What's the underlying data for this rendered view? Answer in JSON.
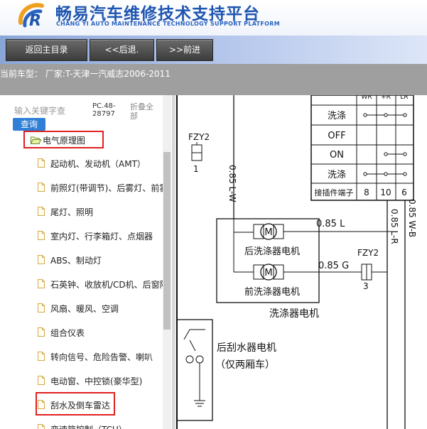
{
  "header": {
    "title_cn": "畅易汽车维修技术支持平台",
    "title_en": "CHANG YI AUTO MAINTENANCE TECHNOLOGY SUPPORT PLATFORM"
  },
  "toolbar": {
    "home_label": "返回主目录",
    "back_label": "<<后退.",
    "forward_label": ">>前进"
  },
  "model_bar": {
    "text": "当前车型： 厂家:T-天津一汽威志2006-2011"
  },
  "search": {
    "placeholder": "输入关键字查",
    "button_label": "查询"
  },
  "doc_code": "PC.48-28797",
  "collapse_label": "折叠全部",
  "tree": {
    "root_label": "电气原理图",
    "items": [
      {
        "label": "起动机、发动机（AMT）"
      },
      {
        "label": "前照灯(带调节)、后雾灯、前雾灯"
      },
      {
        "label": "尾灯、照明"
      },
      {
        "label": "室内灯、行李箱灯、点烟器"
      },
      {
        "label": "ABS、制动灯"
      },
      {
        "label": "石英钟、收放机/CD机、后窗除霜"
      },
      {
        "label": "风扇、暖风、空调"
      },
      {
        "label": "组合仪表"
      },
      {
        "label": "转向信号、危险告警、喇叭"
      },
      {
        "label": "电动窗、中控锁(豪华型)"
      },
      {
        "label": "刮水及倒车雷达"
      },
      {
        "label": "变速箱控制（TCU）"
      }
    ]
  },
  "diagram": {
    "table_header": [
      "WR",
      "+R",
      "LR"
    ],
    "rows": [
      "洗涤",
      "OFF",
      "ON",
      "洗涤"
    ],
    "terminal_label": "接插件端子",
    "terminals": [
      "8",
      "10",
      "6"
    ],
    "fuse_left": "FZY2",
    "fuse_left_num": "1",
    "fuse_right": "FZY2",
    "fuse_right_num": "3",
    "wire_lw": "0.85 L-W",
    "wire_l": "0.85 L",
    "wire_g": "0.85 G",
    "wire_lr": "0.85 L-R",
    "wire_wb": "0.85 W-B",
    "motor_rear": "后洗涤器电机",
    "motor_front": "前洗涤器电机",
    "washer_motor": "洗涤器电机",
    "wiper_motor_line1": "后刮水器电机",
    "wiper_motor_line2": "（仅两厢车）",
    "motor_symbol": "M"
  },
  "colors": {
    "title_blue": "#1e55b0",
    "search_button": "#2f7fd6",
    "highlight_red": "#e02020",
    "model_bar_bg": "#9f9f9f"
  }
}
